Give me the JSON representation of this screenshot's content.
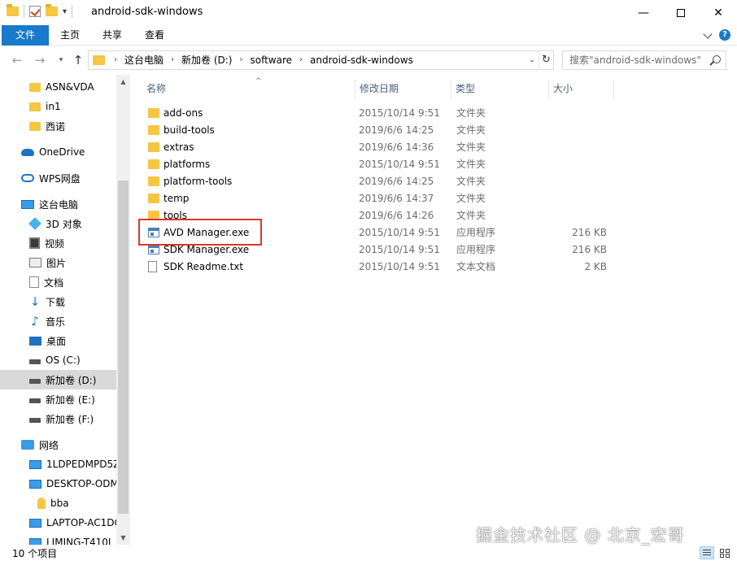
{
  "window": {
    "title": "android-sdk-windows",
    "minimize": "—",
    "close": "✕"
  },
  "ribbon": {
    "tabs": [
      "文件",
      "主页",
      "共享",
      "查看"
    ],
    "help": "?"
  },
  "address": {
    "back": "←",
    "forward": "→",
    "up": "↑",
    "crumbs": [
      "这台电脑",
      "新加卷 (D:)",
      "software",
      "android-sdk-windows"
    ],
    "refresh": "↻"
  },
  "search": {
    "placeholder": "搜索\"android-sdk-windows\""
  },
  "nav": {
    "items": [
      {
        "label": "ASN&VDA",
        "icon": "folder-icon"
      },
      {
        "label": "in1",
        "icon": "folder-icon"
      },
      {
        "label": "西诺",
        "icon": "folder-icon"
      },
      {
        "label": "OneDrive",
        "icon": "cloud-icon"
      },
      {
        "label": "WPS网盘",
        "icon": "wps-cloud-icon"
      },
      {
        "label": "这台电脑",
        "icon": "computer-icon"
      },
      {
        "label": "3D 对象",
        "icon": "3d-objects-icon"
      },
      {
        "label": "视频",
        "icon": "video-icon"
      },
      {
        "label": "图片",
        "icon": "pictures-icon"
      },
      {
        "label": "文档",
        "icon": "documents-icon"
      },
      {
        "label": "下载",
        "icon": "download-icon"
      },
      {
        "label": "音乐",
        "icon": "music-icon"
      },
      {
        "label": "桌面",
        "icon": "desktop-icon"
      },
      {
        "label": "OS (C:)",
        "icon": "os-drive-icon"
      },
      {
        "label": "新加卷 (D:)",
        "icon": "drive-icon"
      },
      {
        "label": "新加卷 (E:)",
        "icon": "drive-icon"
      },
      {
        "label": "新加卷 (F:)",
        "icon": "drive-icon"
      },
      {
        "label": "网络",
        "icon": "network-icon"
      },
      {
        "label": "1LDPEDMPD5Z",
        "icon": "monitor-icon"
      },
      {
        "label": "DESKTOP-ODM",
        "icon": "monitor-icon"
      },
      {
        "label": "bba",
        "icon": "user-icon"
      },
      {
        "label": "LAPTOP-AC1DC",
        "icon": "monitor-icon"
      },
      {
        "label": "LIMING-T410L",
        "icon": "monitor-icon"
      }
    ],
    "selected_label": "新加卷 (D:)"
  },
  "columns": {
    "name": "名称",
    "date": "修改日期",
    "type": "类型",
    "size": "大小"
  },
  "files": [
    {
      "name": "add-ons",
      "date": "2015/10/14 9:51",
      "type": "文件夹",
      "size": "",
      "kind": "folder"
    },
    {
      "name": "build-tools",
      "date": "2019/6/6 14:25",
      "type": "文件夹",
      "size": "",
      "kind": "folder"
    },
    {
      "name": "extras",
      "date": "2019/6/6 14:36",
      "type": "文件夹",
      "size": "",
      "kind": "folder"
    },
    {
      "name": "platforms",
      "date": "2015/10/14 9:51",
      "type": "文件夹",
      "size": "",
      "kind": "folder"
    },
    {
      "name": "platform-tools",
      "date": "2019/6/6 14:25",
      "type": "文件夹",
      "size": "",
      "kind": "folder"
    },
    {
      "name": "temp",
      "date": "2019/6/6 14:37",
      "type": "文件夹",
      "size": "",
      "kind": "folder"
    },
    {
      "name": "tools",
      "date": "2019/6/6 14:26",
      "type": "文件夹",
      "size": "",
      "kind": "folder"
    },
    {
      "name": "AVD Manager.exe",
      "date": "2015/10/14 9:51",
      "type": "应用程序",
      "size": "216 KB",
      "kind": "exe"
    },
    {
      "name": "SDK Manager.exe",
      "date": "2015/10/14 9:51",
      "type": "应用程序",
      "size": "216 KB",
      "kind": "exe"
    },
    {
      "name": "SDK Readme.txt",
      "date": "2015/10/14 9:51",
      "type": "文本文档",
      "size": "2 KB",
      "kind": "txt"
    }
  ],
  "highlighted_file": "AVD Manager.exe",
  "status": {
    "count": "10 个项目"
  },
  "watermark": "掘金技术社区 @ 北京_宏哥",
  "colors": {
    "accent": "#1979ca",
    "folder": "#f4c643",
    "highlight": "#e0352b"
  }
}
